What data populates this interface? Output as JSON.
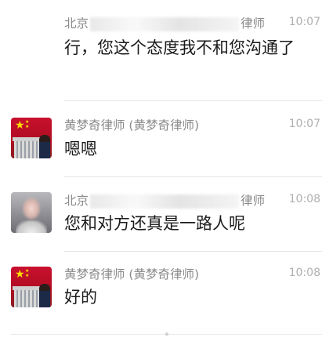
{
  "messages": [
    {
      "name_prefix": "北京",
      "name_suffix": "律师",
      "time": "10:07",
      "text": "行，您这个态度我不和您沟通了"
    },
    {
      "name": "黄梦奇律师 (黄梦奇律师)",
      "time": "10:07",
      "text": "嗯嗯"
    },
    {
      "name_prefix": "北京",
      "name_suffix": "律师",
      "time": "10:08",
      "text": "您和对方还真是一路人呢"
    },
    {
      "name": "黄梦奇律师 (黄梦奇律师)",
      "time": "10:08",
      "text": "好的"
    }
  ]
}
